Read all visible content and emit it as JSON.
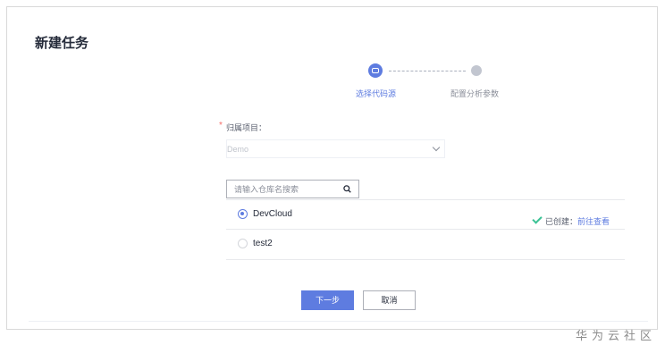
{
  "page": {
    "title": "新建任务"
  },
  "steps": [
    {
      "label": "选择代码源",
      "status": "active"
    },
    {
      "label": "配置分析参数",
      "status": "inactive"
    }
  ],
  "project": {
    "required_mark": "*",
    "label": "归属项目：",
    "selected_value": "Demo"
  },
  "search": {
    "placeholder": "请输入仓库名搜索",
    "value": ""
  },
  "repos": [
    {
      "name": "DevCloud",
      "selected": true,
      "status_text": "已创建：",
      "status_link": "前往查看"
    },
    {
      "name": "test2",
      "selected": false
    }
  ],
  "buttons": {
    "next": "下一步",
    "cancel": "取消"
  },
  "watermark": "华为云社区",
  "colors": {
    "primary": "#5e7ce0",
    "success": "#3ac295",
    "required": "#f66f6a"
  },
  "icons": {
    "step1": "briefcase-icon",
    "search": "search-icon",
    "check": "check-icon",
    "chevron": "chevron-down-icon"
  }
}
